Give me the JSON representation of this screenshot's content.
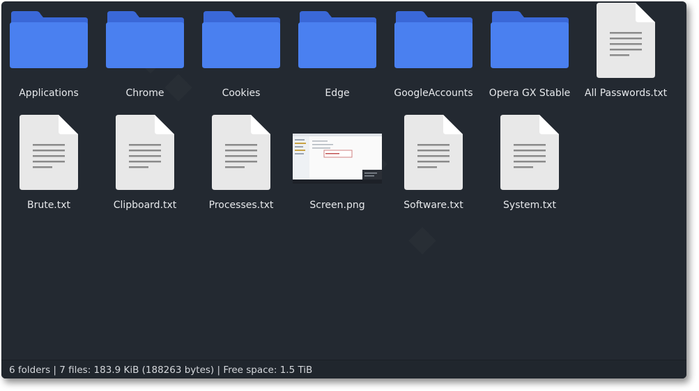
{
  "colors": {
    "background": "#232931",
    "folder_front": "#4a80f0",
    "folder_back": "#3a68d8",
    "doc_paper": "#e8e8e8",
    "doc_fold": "#ffffff",
    "doc_lines": "#8a8a8a",
    "label_text": "#e6e8eb"
  },
  "items": [
    {
      "name": "Applications",
      "kind": "folder",
      "icon": "folder-icon"
    },
    {
      "name": "Chrome",
      "kind": "folder",
      "icon": "folder-icon"
    },
    {
      "name": "Cookies",
      "kind": "folder",
      "icon": "folder-icon"
    },
    {
      "name": "Edge",
      "kind": "folder",
      "icon": "folder-icon"
    },
    {
      "name": "GoogleAccounts",
      "kind": "folder",
      "icon": "folder-icon"
    },
    {
      "name": "Opera GX Stable",
      "kind": "folder",
      "icon": "folder-icon"
    },
    {
      "name": "All Passwords.txt",
      "kind": "text",
      "icon": "text-file-icon"
    },
    {
      "name": "Brute.txt",
      "kind": "text",
      "icon": "text-file-icon"
    },
    {
      "name": "Clipboard.txt",
      "kind": "text",
      "icon": "text-file-icon"
    },
    {
      "name": "Processes.txt",
      "kind": "text",
      "icon": "text-file-icon"
    },
    {
      "name": "Screen.png",
      "kind": "image",
      "icon": "image-thumbnail"
    },
    {
      "name": "Software.txt",
      "kind": "text",
      "icon": "text-file-icon"
    },
    {
      "name": "System.txt",
      "kind": "text",
      "icon": "text-file-icon"
    }
  ],
  "statusbar": {
    "text": "6 folders  |  7 files: 183.9 KiB (188263 bytes)  |  Free space: 1.5 TiB"
  }
}
